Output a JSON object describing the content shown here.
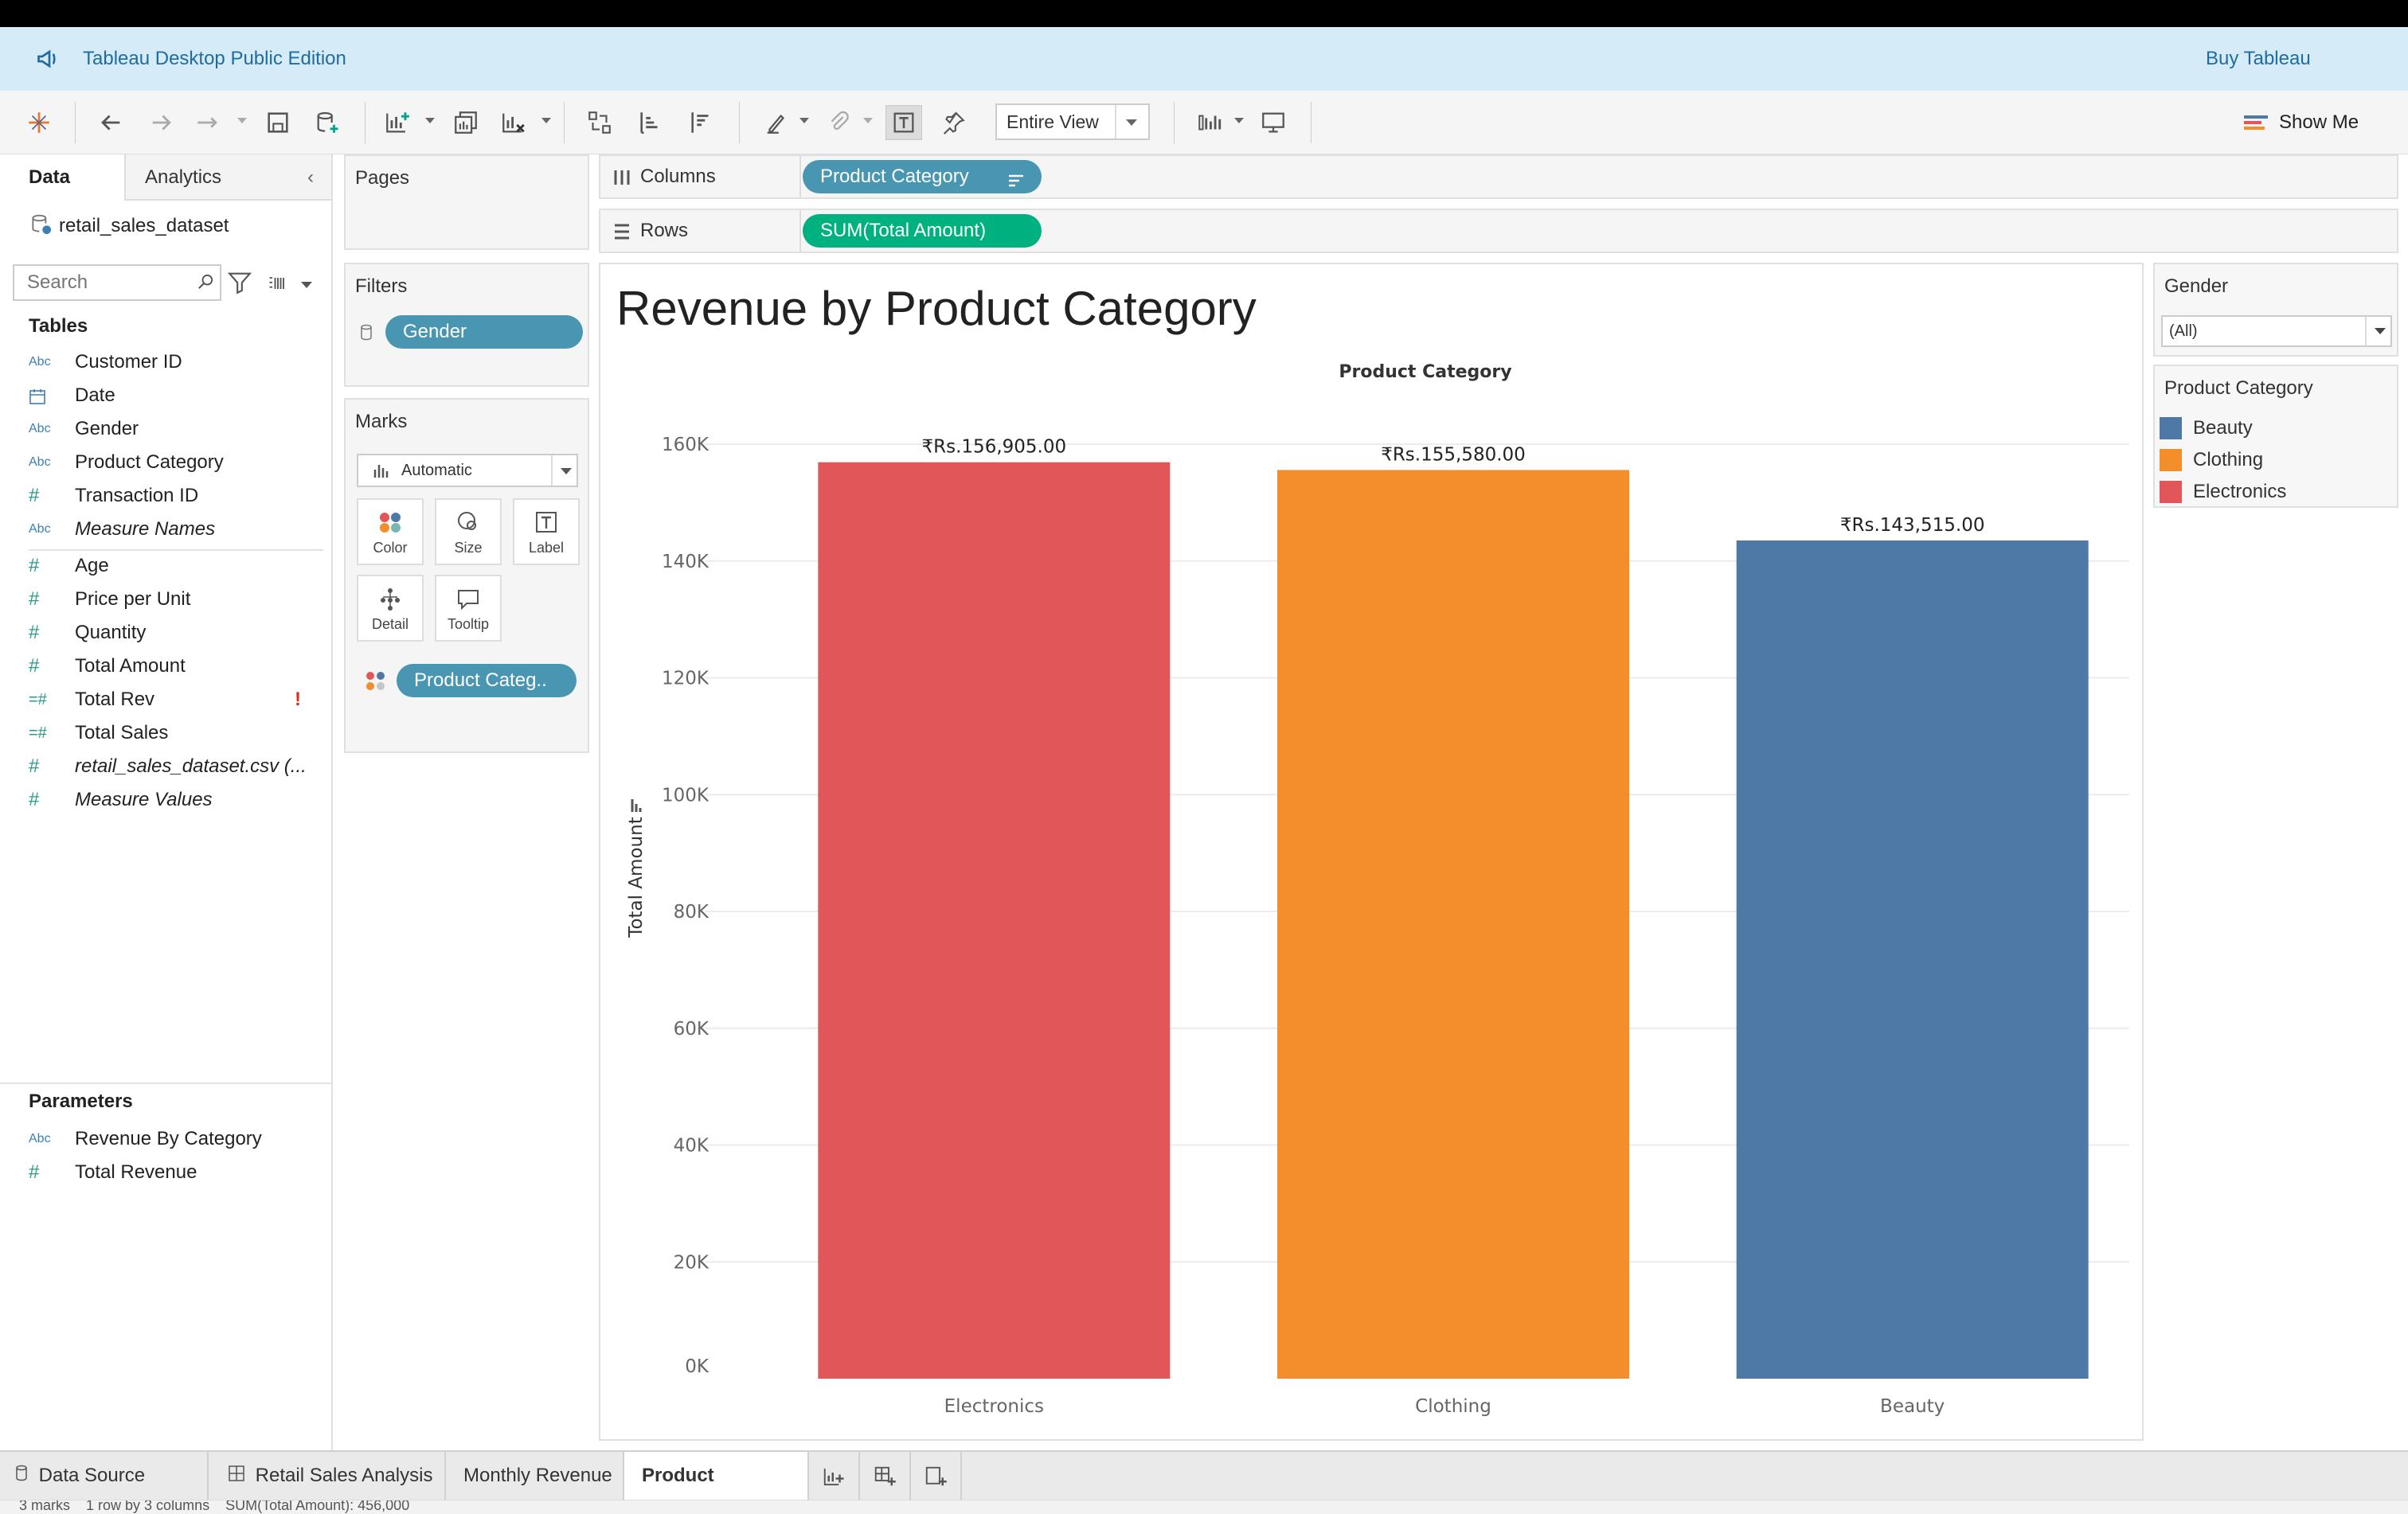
{
  "banner": {
    "title": "Tableau Desktop Public Edition",
    "buy": "Buy Tableau"
  },
  "toolbar": {
    "fit": "Entire View",
    "show_me": "Show Me"
  },
  "left": {
    "tab_data": "Data",
    "tab_analytics": "Analytics",
    "datasource": "retail_sales_dataset",
    "search_placeholder": "Search",
    "tables_title": "Tables",
    "fields": [
      {
        "type": "Abc",
        "name": "Customer ID"
      },
      {
        "type": "date",
        "name": "Date"
      },
      {
        "type": "Abc",
        "name": "Gender"
      },
      {
        "type": "Abc",
        "name": "Product Category"
      },
      {
        "type": "#",
        "name": "Transaction ID"
      },
      {
        "type": "Abc",
        "name": "Measure Names"
      },
      {
        "type": "#",
        "name": "Age"
      },
      {
        "type": "#",
        "name": "Price per Unit"
      },
      {
        "type": "#",
        "name": "Quantity"
      },
      {
        "type": "#",
        "name": "Total Amount"
      },
      {
        "type": "=#",
        "name": "Total Rev"
      },
      {
        "type": "=#",
        "name": "Total Sales"
      },
      {
        "type": "#",
        "name": "retail_sales_dataset.csv (..."
      },
      {
        "type": "#",
        "name": "Measure Values"
      }
    ],
    "error_mark": "!",
    "params_title": "Parameters",
    "params": [
      {
        "type": "Abc",
        "name": "Revenue By Category"
      },
      {
        "type": "#",
        "name": "Total Revenue"
      }
    ]
  },
  "shelves": {
    "pages": "Pages",
    "filters": "Filters",
    "filter_pill": "Gender",
    "marks": "Marks",
    "mark_type": "Automatic",
    "mark_buttons": [
      "Color",
      "Size",
      "Label",
      "Detail",
      "Tooltip"
    ],
    "color_pill": "Product Categ..",
    "columns_label": "Columns",
    "columns_pill": "Product Category",
    "rows_label": "Rows",
    "rows_pill": "SUM(Total Amount)"
  },
  "right": {
    "gender_title": "Gender",
    "gender_value": "(All)",
    "legend_title": "Product Category",
    "legend": [
      {
        "name": "Beauty",
        "color": "#4e79a7"
      },
      {
        "name": "Clothing",
        "color": "#f28e2b"
      },
      {
        "name": "Electronics",
        "color": "#e15759"
      }
    ]
  },
  "chart_data": {
    "type": "bar",
    "title": "Revenue by Product Category",
    "column_header": "Product Category",
    "ylabel": "Total Amount",
    "categories": [
      "Electronics",
      "Clothing",
      "Beauty"
    ],
    "values": [
      156905,
      155580,
      143515
    ],
    "labels": [
      "₹Rs.156,905.00",
      "₹Rs.155,580.00",
      "₹Rs.143,515.00"
    ],
    "colors": [
      "#e15759",
      "#f28e2b",
      "#4e79a7"
    ],
    "ylim": [
      0,
      160000
    ],
    "yticks": [
      0,
      20000,
      40000,
      60000,
      80000,
      100000,
      120000,
      140000,
      160000
    ],
    "ytick_labels": [
      "0K",
      "20K",
      "40K",
      "60K",
      "80K",
      "100K",
      "120K",
      "140K",
      "160K"
    ],
    "grid": true
  },
  "bottom": {
    "tabs": [
      "Data Source",
      "Retail Sales Analysis",
      "Monthly Revenue",
      "Product Category"
    ],
    "status": "3 marks    1 row by 3 columns    SUM(Total Amount): 456,000"
  }
}
